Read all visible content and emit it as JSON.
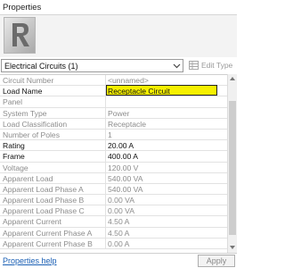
{
  "window": {
    "title": "Properties"
  },
  "type_selector": {
    "value": "Electrical Circuits (1)",
    "edit_type_label": "Edit Type"
  },
  "properties": [
    {
      "name": "Circuit Number",
      "value": "<unnamed>",
      "editable": false
    },
    {
      "name": "Load Name",
      "value": "Receptacle Circuit",
      "editable": true,
      "highlighted": true
    },
    {
      "name": "Panel",
      "value": "",
      "editable": false
    },
    {
      "name": "System Type",
      "value": "Power",
      "editable": false
    },
    {
      "name": "Load Classification",
      "value": "Receptacle",
      "editable": false
    },
    {
      "name": "Number of Poles",
      "value": "1",
      "editable": false
    },
    {
      "name": "Rating",
      "value": "20.00 A",
      "editable": true
    },
    {
      "name": "Frame",
      "value": "400.00 A",
      "editable": true
    },
    {
      "name": "Voltage",
      "value": "120.00 V",
      "editable": false
    },
    {
      "name": "Apparent Load",
      "value": "540.00 VA",
      "editable": false
    },
    {
      "name": "Apparent Load Phase A",
      "value": "540.00 VA",
      "editable": false
    },
    {
      "name": "Apparent Load Phase B",
      "value": "0.00 VA",
      "editable": false
    },
    {
      "name": "Apparent Load Phase C",
      "value": "0.00 VA",
      "editable": false
    },
    {
      "name": "Apparent Current",
      "value": "4.50 A",
      "editable": false
    },
    {
      "name": "Apparent Current Phase A",
      "value": "4.50 A",
      "editable": false
    },
    {
      "name": "Apparent Current Phase B",
      "value": "0.00 A",
      "editable": false
    }
  ],
  "footer": {
    "help_link": "Properties help",
    "apply_label": "Apply"
  },
  "colors": {
    "highlight": "#f6f000",
    "link": "#1a5fb4",
    "readonly_text": "#8c8c8c"
  }
}
